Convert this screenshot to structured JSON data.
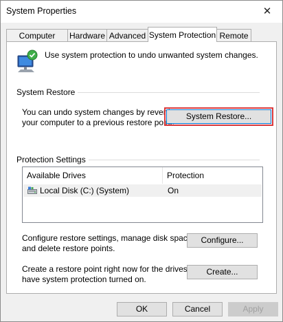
{
  "window": {
    "title": "System Properties",
    "close_glyph": "✕"
  },
  "tabs": [
    {
      "label": "Computer Name",
      "active": false
    },
    {
      "label": "Hardware",
      "active": false
    },
    {
      "label": "Advanced",
      "active": false
    },
    {
      "label": "System Protection",
      "active": true
    },
    {
      "label": "Remote",
      "active": false
    }
  ],
  "intro": {
    "text": "Use system protection to undo unwanted system changes.",
    "icon": "computer-shield-icon"
  },
  "system_restore": {
    "group_label": "System Restore",
    "description_line1": "You can undo system changes by reverting",
    "description_line2": "your computer to a previous restore point.",
    "button_label": "System Restore..."
  },
  "protection_settings": {
    "group_label": "Protection Settings",
    "columns": [
      "Available Drives",
      "Protection"
    ],
    "rows": [
      {
        "drive": "Local Disk (C:) (System)",
        "protection": "On",
        "icon": "disk-drive-icon"
      }
    ],
    "configure_text_line1": "Configure restore settings, manage disk space,",
    "configure_text_line2": "and delete restore points.",
    "configure_label": "Configure...",
    "create_text_line1": "Create a restore point right now for the drives that",
    "create_text_line2": "have system protection turned on.",
    "create_label": "Create..."
  },
  "footer": {
    "ok_label": "OK",
    "cancel_label": "Cancel",
    "apply_label": "Apply"
  },
  "colors": {
    "highlight": "#d9383b",
    "focus": "#0078d7"
  }
}
